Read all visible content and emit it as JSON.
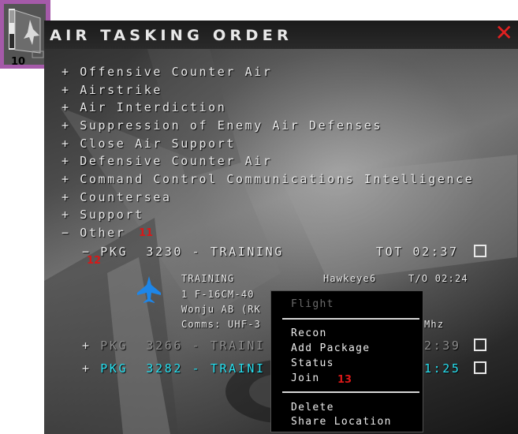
{
  "window": {
    "title": "AIR TASKING ORDER",
    "close_symbol": "✕"
  },
  "categories": [
    {
      "sign": "+",
      "label": "Offensive Counter Air"
    },
    {
      "sign": "+",
      "label": "Airstrike"
    },
    {
      "sign": "+",
      "label": "Air Interdiction"
    },
    {
      "sign": "+",
      "label": "Suppression of Enemy Air Defenses"
    },
    {
      "sign": "+",
      "label": "Close Air Support"
    },
    {
      "sign": "+",
      "label": "Defensive Counter Air"
    },
    {
      "sign": "+",
      "label": "Command Control Communications Intelligence"
    },
    {
      "sign": "+",
      "label": "Countersea"
    },
    {
      "sign": "+",
      "label": "Support"
    },
    {
      "sign": "−",
      "label": "Other"
    }
  ],
  "packages": [
    {
      "sign": "−",
      "label": "PKG  3230 - TRAINING",
      "tot": "TOT 02:37"
    },
    {
      "sign": "+",
      "label": "PKG  3266 - TRAINI",
      "tot": "2:39"
    },
    {
      "sign": "+",
      "label": "PKG  3282 - TRAINI",
      "tot": "1:25"
    }
  ],
  "flight": {
    "mission": "TRAINING",
    "callsign": "Hawkeye6",
    "takeoff": "T/O 02:24",
    "aircraft": "1 F-16CM-40",
    "base": "Wonju AB (RK",
    "comms": "Comms: UHF-3",
    "freq_unit": "Mhz"
  },
  "context_menu": {
    "items": [
      "Flight",
      "Recon",
      "Add Package",
      "Status",
      "Join",
      "Delete",
      "Share Location"
    ]
  },
  "callouts": {
    "other": "11",
    "package": "12",
    "join": "13",
    "icon": "10"
  },
  "colors": {
    "accent_cyan": "#27e0f0",
    "close_red": "#e02020",
    "callout_red": "#d81818",
    "icon_frame": "#a55aa9"
  },
  "icons": {
    "jet": "fighter-jet-icon",
    "app": "ato-folder-icon"
  }
}
